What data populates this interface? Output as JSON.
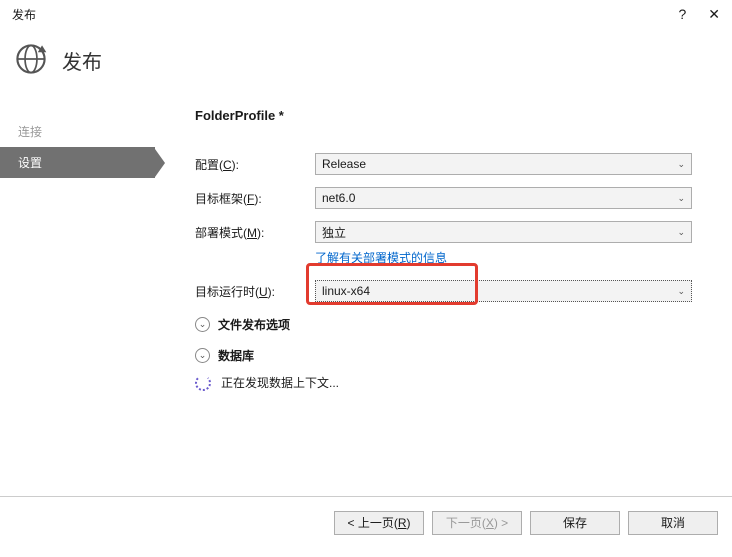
{
  "titlebar": {
    "title": "发布",
    "help": "?",
    "close": "✕"
  },
  "header": {
    "title": "发布"
  },
  "sidebar": {
    "items": [
      {
        "label": "连接"
      },
      {
        "label": "设置"
      }
    ]
  },
  "main": {
    "profile_title": "FolderProfile *",
    "fields": {
      "config": {
        "label_pre": "配置(",
        "hotkey": "C",
        "label_post": "):",
        "value": "Release"
      },
      "framework": {
        "label_pre": "目标框架(",
        "hotkey": "F",
        "label_post": "):",
        "value": "net6.0"
      },
      "deploy": {
        "label_pre": "部署模式(",
        "hotkey": "M",
        "label_post": "):",
        "value": "独立"
      },
      "deploy_link": "了解有关部署模式的信息",
      "runtime": {
        "label_pre": "目标运行时(",
        "hotkey": "U",
        "label_post": "):",
        "value": "linux-x64"
      }
    },
    "expanders": {
      "file_publish": "文件发布选项",
      "database": "数据库"
    },
    "discovering": "正在发现数据上下文..."
  },
  "footer": {
    "prev_pre": "< 上一页(",
    "prev_key": "R",
    "prev_post": ")",
    "next_pre": "下一页(",
    "next_key": "X",
    "next_post": ") >",
    "save": "保存",
    "cancel": "取消"
  }
}
